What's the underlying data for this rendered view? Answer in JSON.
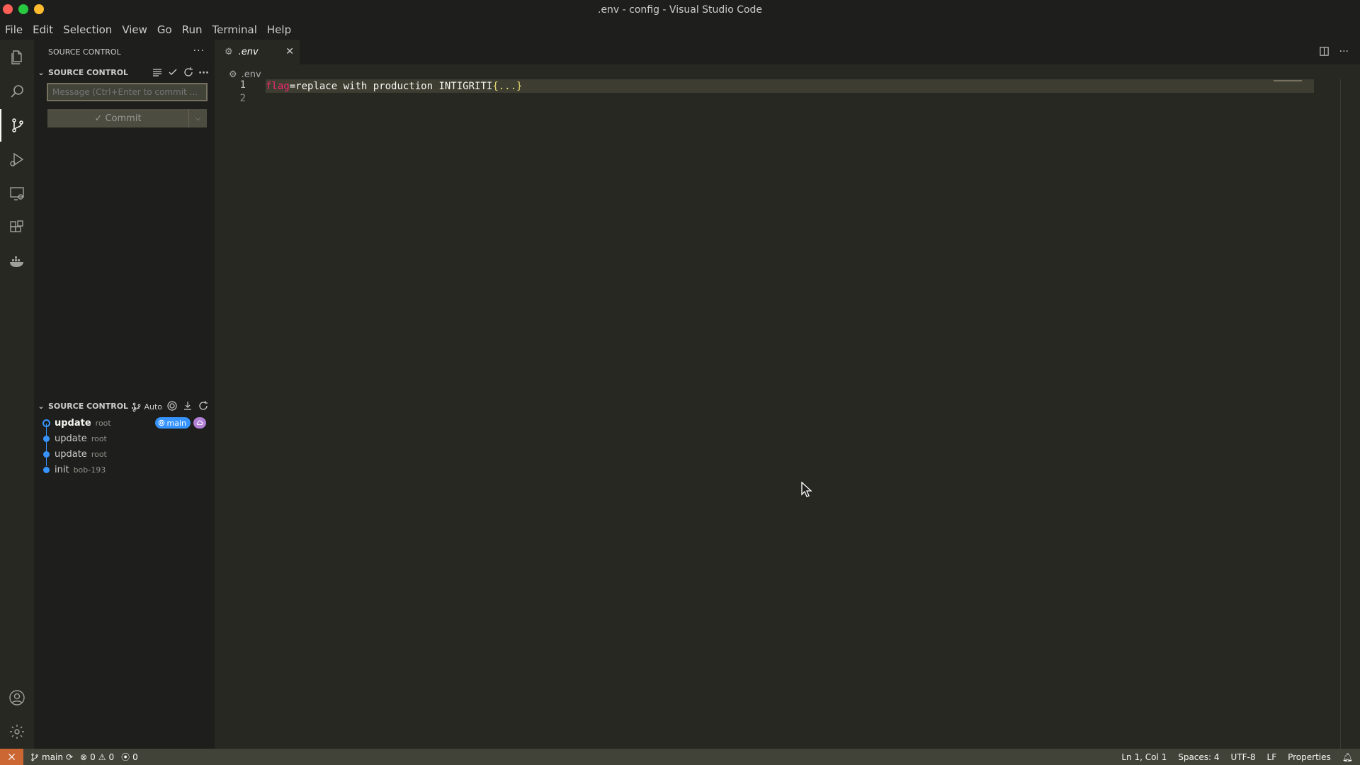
{
  "window": {
    "title": ".env - config - Visual Studio Code",
    "traffic_colors": [
      "#ff5f57",
      "#28c840",
      "#febc2e"
    ]
  },
  "menu": [
    "File",
    "Edit",
    "Selection",
    "View",
    "Go",
    "Run",
    "Terminal",
    "Help"
  ],
  "activity_bar": {
    "items": [
      "explorer-icon",
      "search-icon",
      "source-control-icon",
      "run-debug-icon",
      "remote-explorer-icon",
      "extensions-icon",
      "docker-icon"
    ],
    "active": "source-control-icon",
    "bottom": [
      "account-icon",
      "settings-gear-icon"
    ]
  },
  "sidebar": {
    "header": "SOURCE CONTROL",
    "section_title": "SOURCE CONTROL",
    "message_placeholder": "Message (Ctrl+Enter to commit ...",
    "commit_label": "Commit",
    "graph": {
      "title": "SOURCE CONTROL ...",
      "auto_label": "Auto",
      "commits": [
        {
          "title": "update",
          "author": "root",
          "current": true
        },
        {
          "title": "update",
          "author": "root",
          "current": false
        },
        {
          "title": "update",
          "author": "root",
          "current": false
        },
        {
          "title": "init",
          "author": "bob-193",
          "current": false
        }
      ],
      "branch_badge": "main"
    }
  },
  "editor": {
    "tab_label": ".env",
    "breadcrumb": ".env",
    "lines": [
      {
        "number": "1",
        "key": "flag",
        "eq": "=",
        "value": "replace with production INTIGRITI",
        "brace": "{...}"
      },
      {
        "number": "2",
        "key": "",
        "eq": "",
        "value": "",
        "brace": ""
      }
    ]
  },
  "status": {
    "branch": "main",
    "errors": "0",
    "warnings": "0",
    "ports": "0",
    "position": "Ln 1, Col 1",
    "spaces": "Spaces: 4",
    "encoding": "UTF-8",
    "eol": "LF",
    "language": "Properties"
  }
}
